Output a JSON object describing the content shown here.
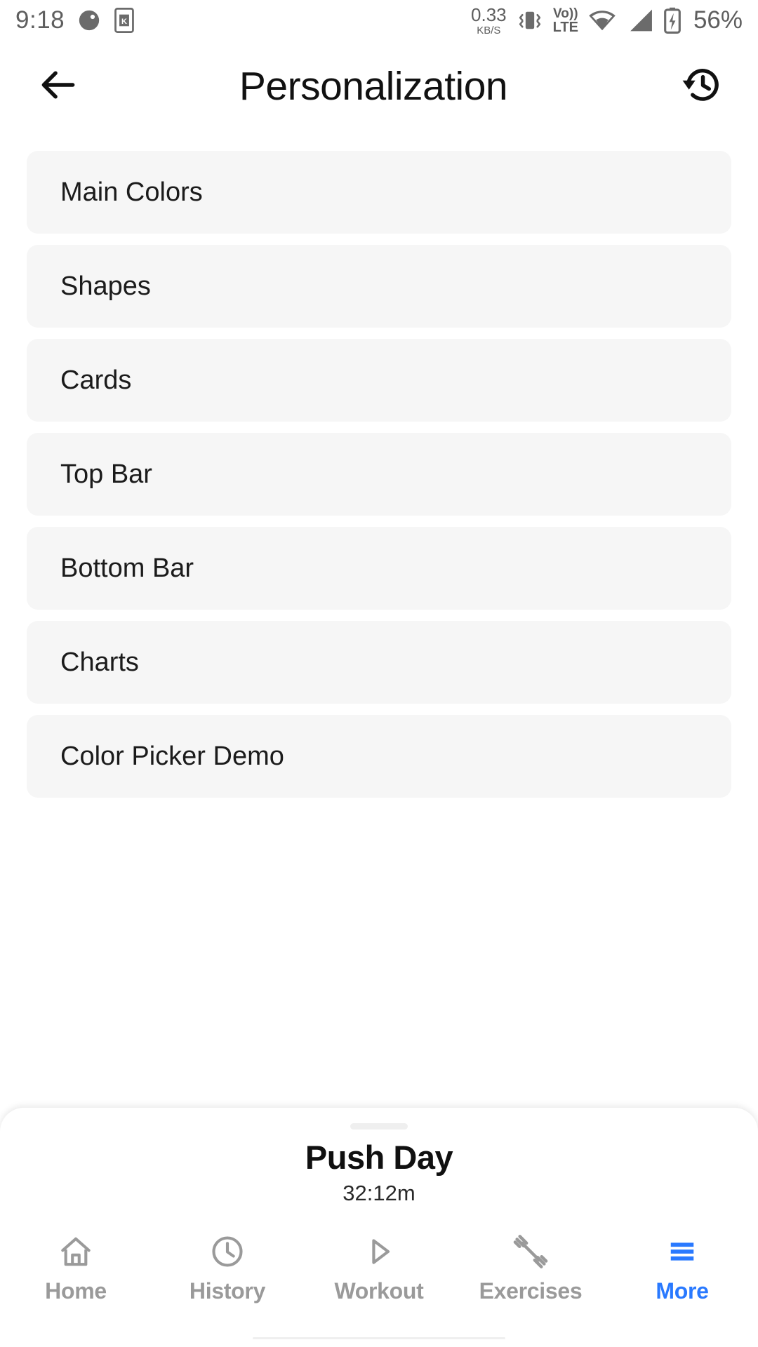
{
  "statusbar": {
    "time": "9:18",
    "notification_icons": [
      "half-moon-icon",
      "kindle-app-icon"
    ],
    "data_rate_value": "0.33",
    "data_rate_unit": "KB/S",
    "vibrate_icon": "vibrate-icon",
    "volte_top": "Vo))",
    "volte_bottom": "LTE",
    "wifi_icon": "wifi-icon",
    "signal_icon": "cellular-signal-icon",
    "battery_icon": "battery-charging-icon",
    "battery_percent": "56%"
  },
  "appbar": {
    "back_icon": "arrow-left-icon",
    "title": "Personalization",
    "action_icon": "history-restore-icon"
  },
  "settings_list": [
    {
      "label": "Main Colors"
    },
    {
      "label": "Shapes"
    },
    {
      "label": "Cards"
    },
    {
      "label": "Top Bar"
    },
    {
      "label": "Bottom Bar"
    },
    {
      "label": "Charts"
    },
    {
      "label": "Color Picker Demo"
    }
  ],
  "workout_sheet": {
    "title": "Push Day",
    "elapsed": "32:12m"
  },
  "bottom_nav": {
    "active_color": "#2979ff",
    "inactive_color": "#9a9a9a",
    "items": [
      {
        "label": "Home",
        "icon": "home-icon",
        "active": false
      },
      {
        "label": "History",
        "icon": "clock-icon",
        "active": false
      },
      {
        "label": "Workout",
        "icon": "play-triangle-icon",
        "active": false
      },
      {
        "label": "Exercises",
        "icon": "dumbbell-icon",
        "active": false
      },
      {
        "label": "More",
        "icon": "hamburger-menu-icon",
        "active": true
      }
    ]
  },
  "colors": {
    "card_background": "#f6f6f6",
    "page_background": "#ffffff",
    "text_primary": "#1b1b1b",
    "accent": "#2979ff"
  }
}
